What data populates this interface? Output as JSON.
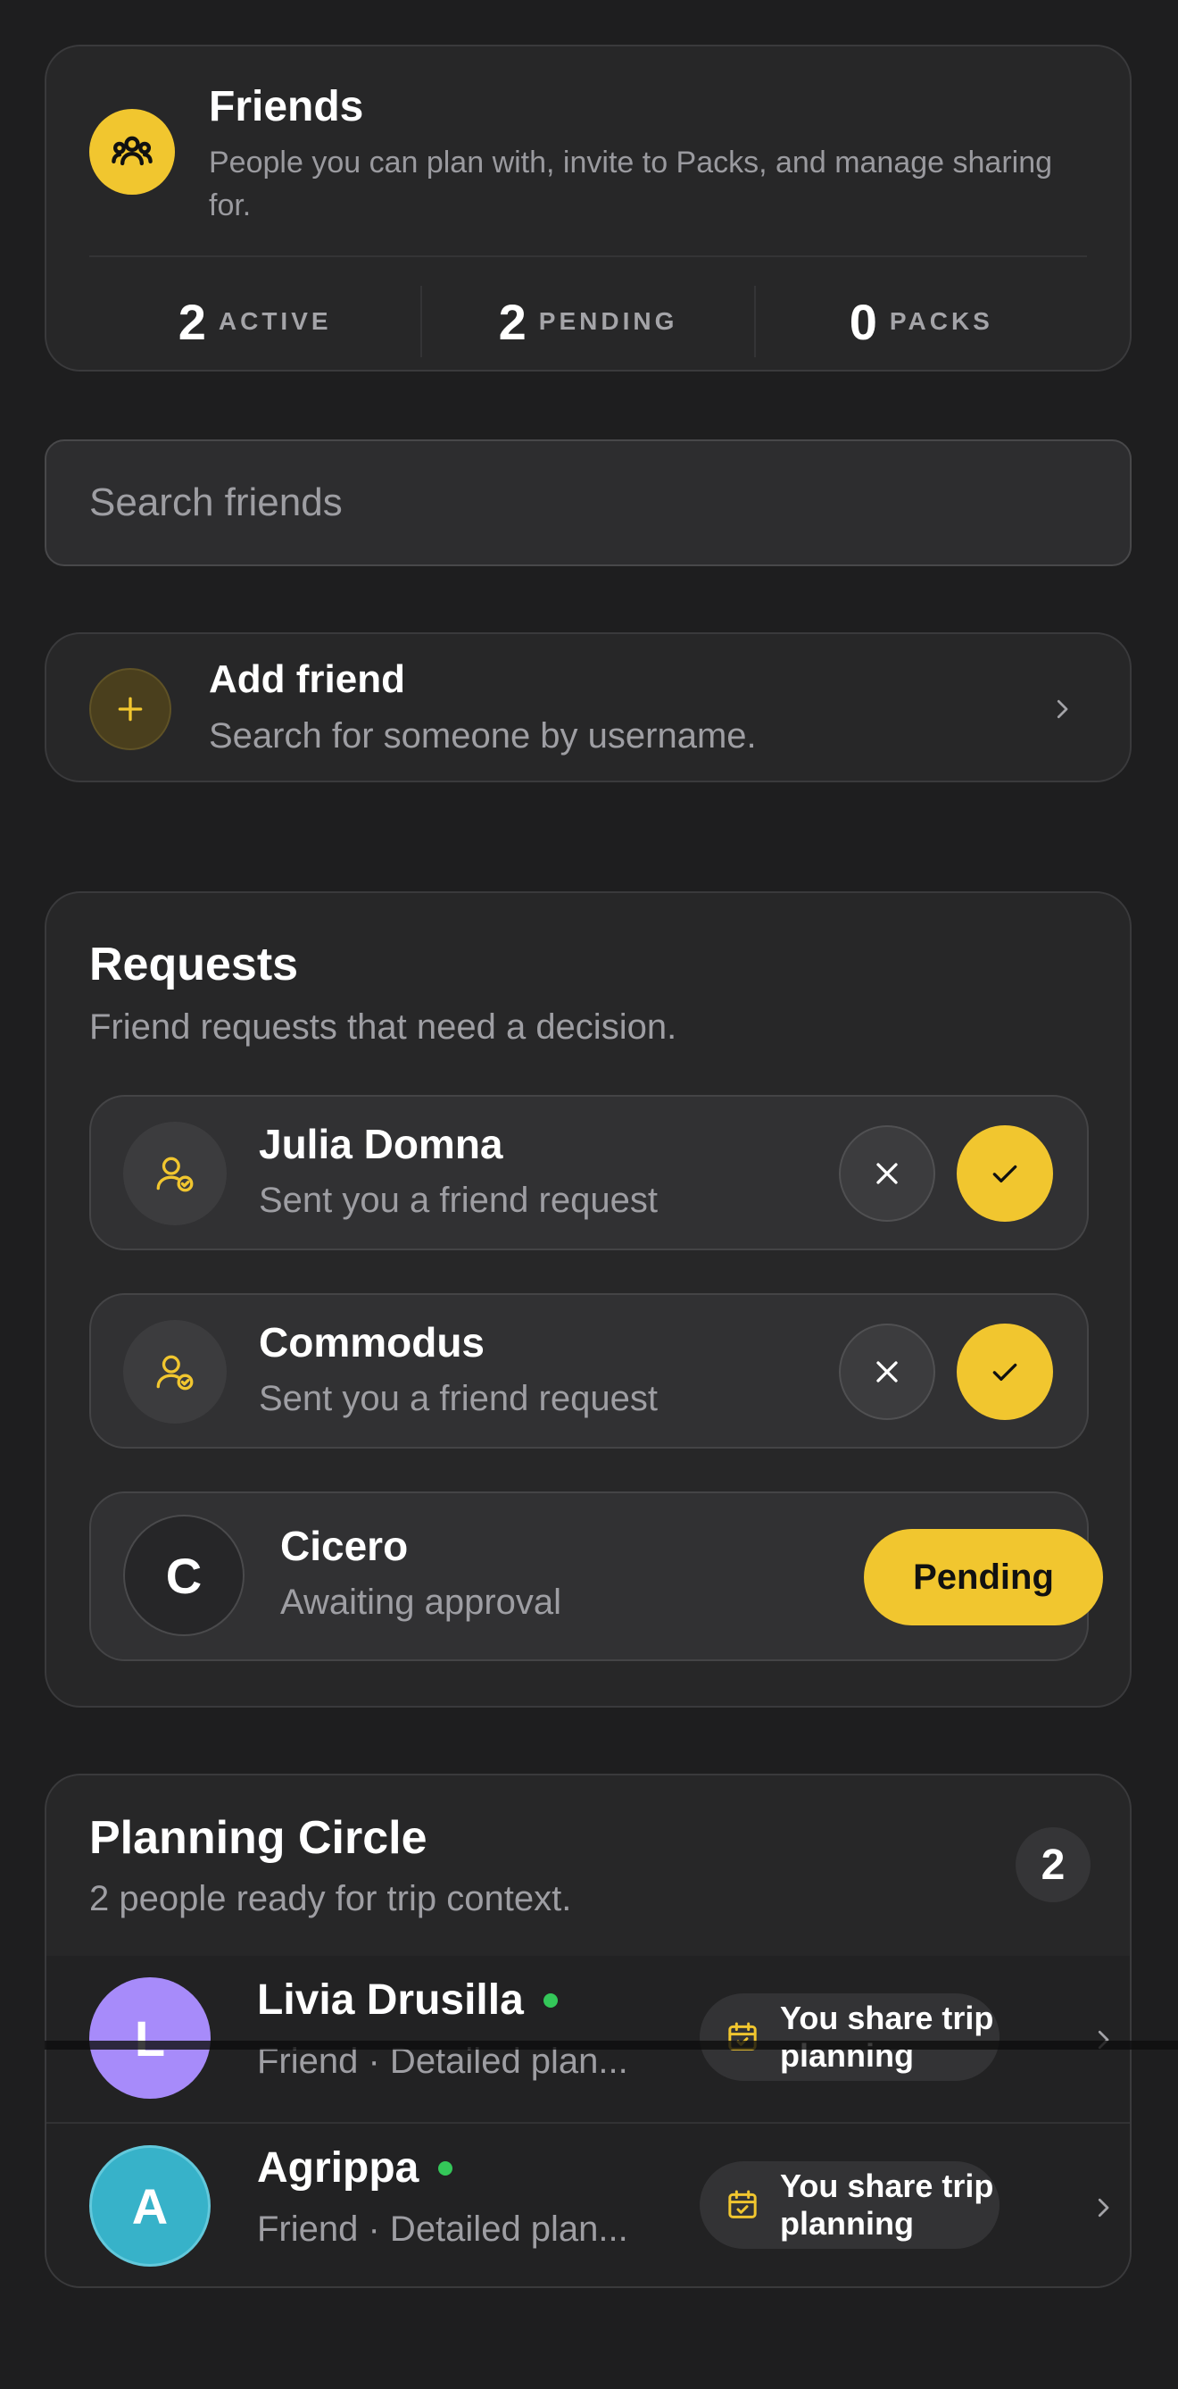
{
  "header": {
    "title": "Friends",
    "subtitle": "People you can plan with, invite to Packs, and manage sharing for.",
    "icon": "people-group-icon",
    "stats": [
      {
        "value": "2",
        "label": "ACTIVE"
      },
      {
        "value": "2",
        "label": "PENDING"
      },
      {
        "value": "0",
        "label": "PACKS"
      }
    ]
  },
  "search": {
    "placeholder": "Search friends",
    "value": ""
  },
  "add_friend": {
    "title": "Add friend",
    "subtitle": "Search for someone by username.",
    "icon": "plus-icon"
  },
  "requests": {
    "title": "Requests",
    "subtitle": "Friend requests that need a decision.",
    "items": [
      {
        "name": "Julia Domna",
        "status": "Sent you a friend request",
        "icon": "user-check-icon"
      },
      {
        "name": "Commodus",
        "status": "Sent you a friend request",
        "icon": "user-check-icon"
      }
    ],
    "outgoing": {
      "initial": "C",
      "name": "Cicero",
      "status": "Awaiting approval",
      "button": "Pending"
    }
  },
  "planning": {
    "title": "Planning Circle",
    "subtitle": "2 people ready for trip context.",
    "count": "2",
    "members": [
      {
        "initial": "L",
        "name": "Livia Drusilla",
        "detail": "Friend · Detailed plan...",
        "pill": "You share trip planning",
        "avatar_color": "#a78bfa",
        "online": true
      },
      {
        "initial": "A",
        "name": "Agrippa",
        "detail": "Friend · Detailed plan...",
        "pill": "You share trip planning",
        "avatar_color": "#37b2c9",
        "online": true
      }
    ]
  },
  "colors": {
    "accent": "#f1c62f",
    "background": "#1e1e1f",
    "card": "#272728",
    "online": "#34c759"
  }
}
